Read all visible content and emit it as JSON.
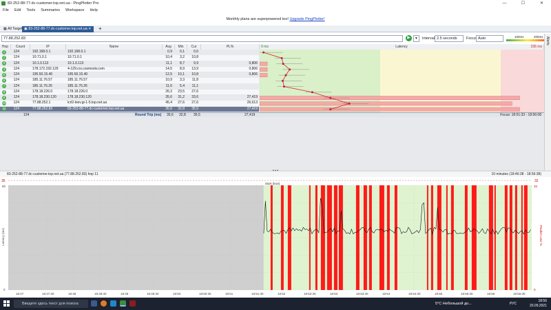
{
  "window": {
    "title": "83-252-88-77.dc-customer.top.net.ua - PingPlotter Pro",
    "min": "—",
    "max": "☐",
    "close": "✕"
  },
  "menu": [
    "File",
    "Edit",
    "Tools",
    "Summaries",
    "Workspace",
    "Help"
  ],
  "banner": {
    "text": "Monthly plans are superpowered too! ",
    "link": "Upgrade PingPlotter!"
  },
  "tabs": {
    "all": "All Targets",
    "active": "83-252-88-77.dc-customer.top.net.ua",
    "plus": "+"
  },
  "toolbar": {
    "target": "77.88.252.83",
    "interval_label": "Interval",
    "interval_value": "2.5 seconds",
    "focus_label": "Focus",
    "focus_value": "Auto",
    "legend_low": "100ms",
    "legend_high": "200ms"
  },
  "sidetab": "Alerts",
  "table": {
    "headers": {
      "hop": "Hop",
      "count": "Count",
      "ip": "IP",
      "name": "Name",
      "avg": "Avg",
      "min": "Min",
      "cur": "Cur",
      "pl": "PL%",
      "latency": "Latency",
      "scale_low": "0 ms",
      "scale_high": "236 ms"
    },
    "rows": [
      {
        "hop": "1",
        "count": "124",
        "ip": "192.168.0.1",
        "name": "192.168.0.1",
        "avg": "0,9",
        "min": "0,1",
        "cur": "0,6",
        "pl": ""
      },
      {
        "hop": "2",
        "count": "124",
        "ip": "10.71.0.1",
        "name": "10.71.0.1",
        "avg": "10,4",
        "min": "3,2",
        "cur": "10,8",
        "pl": ""
      },
      {
        "hop": "3",
        "count": "124",
        "ip": "10.1.0.113",
        "name": "10.1.0.113",
        "avg": "11,1",
        "min": "8,7",
        "cur": "9,9",
        "pl": "0,806"
      },
      {
        "hop": "4",
        "count": "124",
        "ip": "178.172.192.129",
        "name": "4-129.crs.cosmostv.com",
        "avg": "14,5",
        "min": "8,9",
        "cur": "13,9",
        "pl": "0,806"
      },
      {
        "hop": "5",
        "count": "124",
        "ip": "195.50.15.40",
        "name": "195.50.15.40",
        "avg": "12,5",
        "min": "10,1",
        "cur": "10,8",
        "pl": "0,806"
      },
      {
        "hop": "6",
        "count": "124",
        "ip": "185.11.76.57",
        "name": "185.11.76.57",
        "avg": "10,9",
        "min": "3,3",
        "cur": "11,8",
        "pl": ""
      },
      {
        "hop": "7",
        "count": "124",
        "ip": "185.11.76.26",
        "name": "185.11.76.26",
        "avg": "11,6",
        "min": "5,4",
        "cur": "11,1",
        "pl": ""
      },
      {
        "hop": "8",
        "count": "124",
        "ip": "178.18.226.0",
        "name": "178.18.226.0",
        "avg": "26,2",
        "min": "23,5",
        "cur": "27,6",
        "pl": ""
      },
      {
        "hop": "9",
        "count": "124",
        "ip": "178.18.230.120",
        "name": "178.18.230.120",
        "avg": "35,6",
        "min": "31,2",
        "cur": "33,6",
        "pl": "27,419"
      },
      {
        "hop": "10",
        "count": "124",
        "ip": "77.88.252.1",
        "name": "lcrl2-kiev.gi-1-5.top.net.ua",
        "avg": "45,4",
        "min": "27,6",
        "cur": "27,6",
        "pl": "26,613"
      },
      {
        "hop": "11",
        "count": "124",
        "ip": "77.88.252.83",
        "name": "83-252-88-77.dc-customer.top.net.ua",
        "avg": "35,6",
        "min": "32,8",
        "cur": "35,5",
        "pl": "27,419"
      }
    ],
    "summary": {
      "count": "124",
      "label": "Round Trip (ms)",
      "avg": "35,6",
      "min": "32,8",
      "cur": "35,5",
      "pl": "27,419",
      "focus": "Focus: 18:51:33 - 18:56:08"
    }
  },
  "latency_values": [
    0.9,
    10.4,
    11.1,
    14.5,
    12.5,
    10.9,
    11.6,
    26.2,
    35.6,
    45.4,
    35.6
  ],
  "graph": {
    "title": "83-252-88-77.dc-customer.top.net.ua (77.88.252.83) hop 11",
    "range": "10 minutes (18:46:38 - 18:56:38)",
    "y_label": "Latency (ms)",
    "y_right_label": "Packet Loss %",
    "y_max_ms": "60",
    "y_max_pl": "32",
    "y_min_ms": "0",
    "y_min_pl": "0",
    "left_marker": "35",
    "right_marker": "32",
    "ticks": [
      "18:47",
      "18:47:30",
      "18:48",
      "18:48:30",
      "18:49",
      "18:49:30",
      "18:50",
      "18:50:30",
      "18:51",
      "18:51:30",
      "18:52",
      "18:52:30",
      "18:53",
      "18:53:30",
      "18:54",
      "18:54:30",
      "18:55",
      "18:55:30",
      "18:56",
      "18:56:30"
    ],
    "data_start": "18:51:33",
    "data_start_label": "Start (true)"
  },
  "taskbar": {
    "search": "Введите здесь текст для поиска",
    "weather": "5°C  Небольшой до...",
    "lang": "РУС",
    "time": "18:56",
    "date": "20.09.2021"
  },
  "colors": {
    "green_zone": "#d9f0c9",
    "yellow_zone": "#fbf6d2",
    "red_zone": "#f9d9d9",
    "loss": "#ff1a1a",
    "accent": "#2e5a96"
  }
}
